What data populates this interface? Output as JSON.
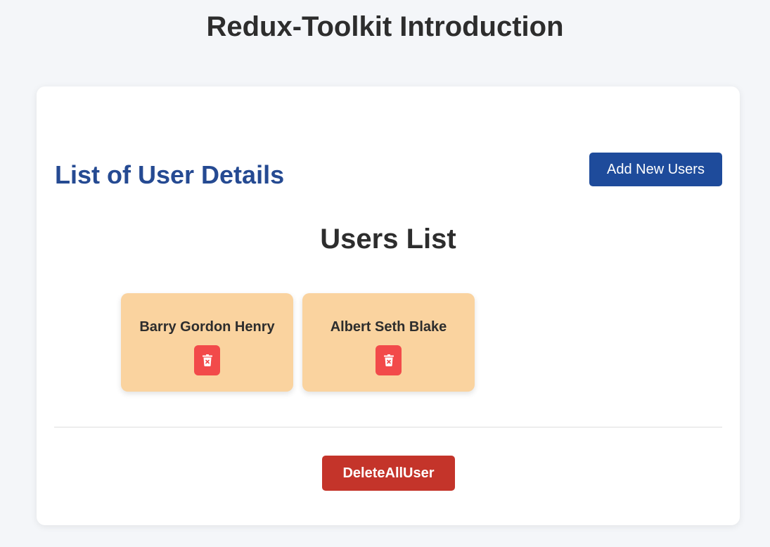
{
  "header": {
    "title": "Redux-Toolkit Introduction"
  },
  "main": {
    "section_title": "List of User Details",
    "add_button_label": "Add New Users",
    "list_title": "Users List",
    "users": [
      {
        "name": "Barry Gordon Henry",
        "delete_icon": "trash-icon"
      },
      {
        "name": "Albert Seth Blake",
        "delete_icon": "trash-icon"
      }
    ],
    "delete_all_label": "DeleteAllUser"
  },
  "colors": {
    "page_background": "#f4f6f9",
    "section_title": "#254a92",
    "add_button": "#1e4b9b",
    "user_card": "#fad39f",
    "delete_icon_button": "#f24a4a",
    "delete_all_button": "#c4342a"
  }
}
